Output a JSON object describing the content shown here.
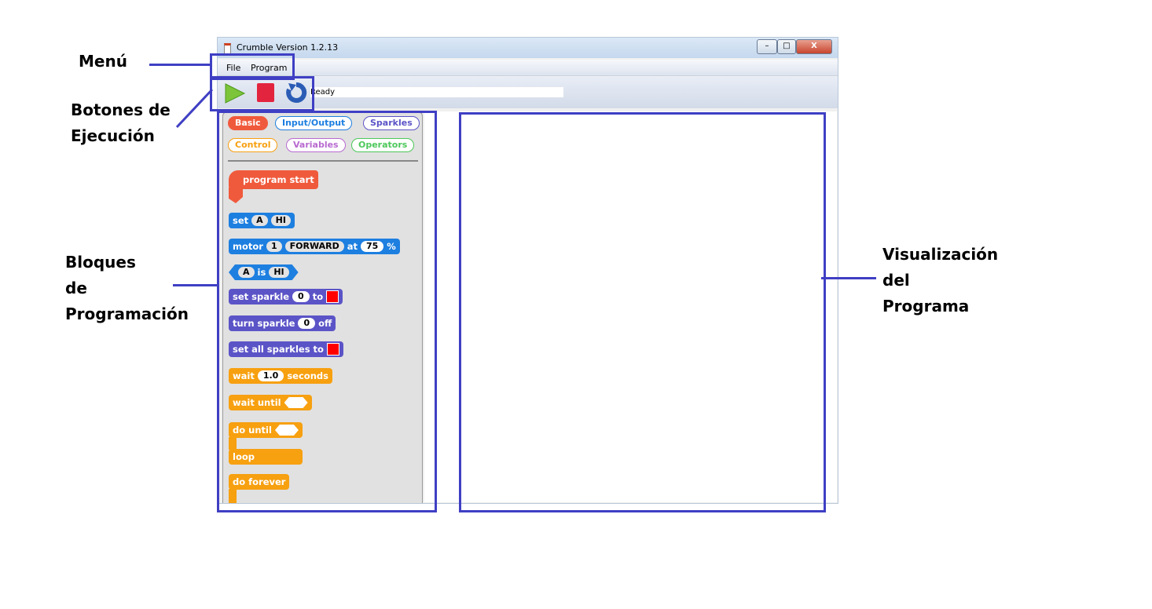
{
  "window": {
    "title": "Crumble Version 1.2.13",
    "minimize": "–",
    "maximize": "□",
    "close": "X"
  },
  "menu": [
    {
      "label": "File"
    },
    {
      "label": "Program"
    }
  ],
  "toolbar": {
    "run_icon": "play-icon",
    "stop_icon": "stop-icon",
    "reset_icon": "reset-icon",
    "status": "Ready"
  },
  "categories": [
    {
      "label": "Basic",
      "color": "#f05a3c"
    },
    {
      "label": "Input/Output",
      "color": "#1d7fe0"
    },
    {
      "label": "Sparkles",
      "color": "#5b54c7"
    },
    {
      "label": "Control",
      "color": "#f7a010"
    },
    {
      "label": "Variables",
      "color": "#b86ad0"
    },
    {
      "label": "Operators",
      "color": "#4cc85a"
    }
  ],
  "blocks": {
    "program_start": "program start",
    "set": {
      "label": "set",
      "pin": "A",
      "value": "HI"
    },
    "motor": {
      "label": "motor",
      "num": "1",
      "dir": "FORWARD",
      "at": "at",
      "speed": "75",
      "pct": "%"
    },
    "is": {
      "pin": "A",
      "is": "is",
      "value": "HI"
    },
    "set_sparkle": {
      "label": "set sparkle",
      "num": "0",
      "to": "to"
    },
    "turn_sparkle": {
      "label": "turn sparkle",
      "num": "0",
      "off": "off"
    },
    "set_all": "set all sparkles to",
    "wait": {
      "label": "wait",
      "value": "1.0",
      "unit": "seconds"
    },
    "wait_until": "wait until",
    "do_until": "do until",
    "loop": "loop",
    "do_forever": "do forever"
  },
  "annotations": {
    "menu": "Menú",
    "buttons": [
      "Botones de",
      "Ejecución"
    ],
    "blocks": [
      "Bloques",
      "de",
      "Programación"
    ],
    "view": [
      "Visualización",
      "del",
      "Programa"
    ],
    "color": "#3f3fc4"
  }
}
